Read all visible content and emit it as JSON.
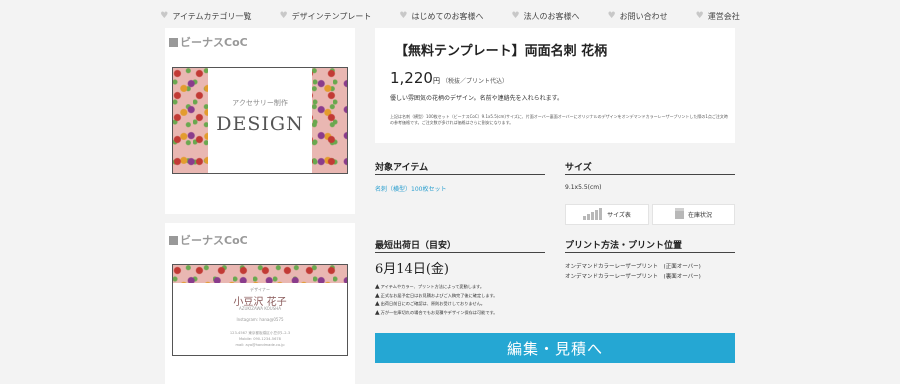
{
  "nav": {
    "items": [
      {
        "label": "アイテムカテゴリ一覧"
      },
      {
        "label": "デザインテンプレート"
      },
      {
        "label": "はじめてのお客様へ"
      },
      {
        "label": "法人のお客様へ"
      },
      {
        "label": "お問い合わせ"
      },
      {
        "label": "運営会社"
      }
    ]
  },
  "previews": [
    {
      "label": "ビーナスCoC",
      "sub": "アクセサリー制作",
      "main": "DESIGN"
    },
    {
      "label": "ビーナスCoC",
      "role": "デザイナー",
      "name": "小豆沢 花子",
      "kana": "AZUKIZAWA  KOUSHA",
      "insta": "Instagram: hana@0575",
      "info": [
        "123-4567 東京都板橋区小豆沢1-2-3",
        "Mobile: 090-1234-5678",
        "mail: aya@handmade.co.jp"
      ]
    }
  ],
  "product": {
    "title": "【無料テンプレート】両面名刺 花柄",
    "price": "1,220",
    "price_unit": "円",
    "price_note": "（税抜／プリント代込）",
    "desc": "優しい雰囲気の花柄のデザイン。名前や連絡先を入れられます。",
    "fine": "上記は名刺（横型）100枚セット（ビーナスCoC）9.1x5.5(cm)サイズに、片面オーバー裏面オーバーにオリジナルのデザインをオンデマンドカラーレーザープリントした際の1点ご注文時の参考価格です。ご注文数が多ければ価格はさらに割安になります。"
  },
  "item": {
    "title": "対象アイテム",
    "link": "名刺（横型）100枚セット"
  },
  "size": {
    "title": "サイズ",
    "value": "9.1x5.5(cm)",
    "size_table": "サイズ表",
    "stock": "在庫状況"
  },
  "ship": {
    "title": "最短出荷日（目安）",
    "date": "6月14日(金)",
    "notes": [
      "アイテムやカラー、プリント方法によって変動します。",
      "正式なお届予定日はお見積およびご入稿完了後に確定します。",
      "出荷日前日にのご確認は、原則お受けしておりません。",
      "万が一在庫切れの場合でもお見積やデザイン保存は可能です。"
    ]
  },
  "print": {
    "title": "プリント方法・プリント位置",
    "lines": [
      "オンデマンドカラーレーザープリント　(正面オーバー)",
      "オンデマンドカラーレーザープリント　(裏面オーバー)"
    ]
  },
  "cta": {
    "label": "編集・見積へ"
  }
}
